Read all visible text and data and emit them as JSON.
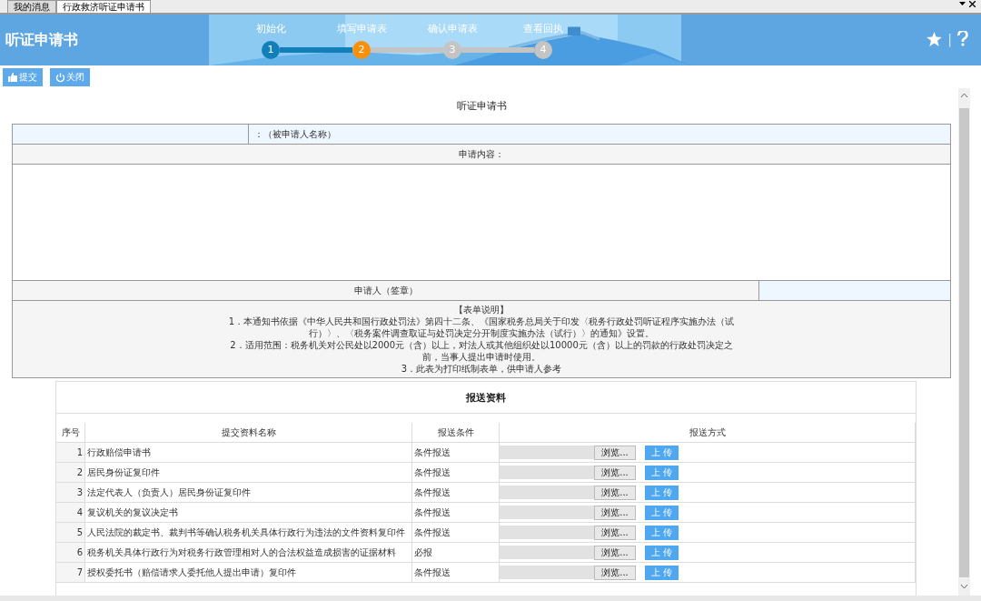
{
  "tabs": [
    {
      "label": "我的消息",
      "selected": false
    },
    {
      "label": "行政救济听证申请书",
      "selected": true
    }
  ],
  "header": {
    "title": "听证申请书",
    "steps": [
      {
        "label": "初始化",
        "number": "1",
        "completed": true,
        "selected": false
      },
      {
        "label": "填写申请表",
        "number": "2",
        "completed": false,
        "selected": true
      },
      {
        "label": "确认申请表",
        "number": "3",
        "completed": false,
        "selected": false
      },
      {
        "label": "查看回执",
        "number": "4",
        "completed": false,
        "selected": false
      }
    ],
    "divider": "|"
  },
  "toolbar": [
    {
      "kind": "submit",
      "label": "提交"
    },
    {
      "kind": "close",
      "label": "关闭"
    }
  ],
  "form": {
    "title": "听证申请书",
    "applicant_name_label": "：（被申请人名称）",
    "content_label": "申请内容：",
    "signature_label": "申请人（签章）",
    "notes_title": "【表单说明】",
    "notes": [
      "1．本通知书依据《中华人民共和国行政处罚法》第四十二条、《国家税务总局关于印发〈税务行政处罚听证程序实施办法（试行）〉、〈税务案件调查取证与处罚决定分开制度实施办法（试行）〉的通知》设置。",
      "2．适用范围：税务机关对公民处以2000元（含）以上，对法人或其他组织处以10000元（含）以上的罚款的行政处罚决定之前，当事人提出申请时使用。",
      "3．此表为打印纸制表单，供申请人参考"
    ]
  },
  "materials": {
    "title": "报送资料",
    "columns": [
      "序号",
      "提交资料名称",
      "报送条件",
      "报送方式"
    ],
    "rows": [
      {
        "index": "1",
        "name": "行政赔偿申请书",
        "condition": "条件报送",
        "browse": "浏览...",
        "upload": "上 传"
      },
      {
        "index": "2",
        "name": "居民身份证复印件",
        "condition": "条件报送",
        "browse": "浏览...",
        "upload": "上 传"
      },
      {
        "index": "3",
        "name": "法定代表人（负责人）居民身份证复印件",
        "condition": "条件报送",
        "browse": "浏览...",
        "upload": "上 传"
      },
      {
        "index": "4",
        "name": "复议机关的复议决定书",
        "condition": "条件报送",
        "browse": "浏览...",
        "upload": "上 传"
      },
      {
        "index": "5",
        "name": "人民法院的裁定书、裁判书等确认税务机关具体行政行为违法的文件资料复印件",
        "condition": "条件报送",
        "browse": "浏览...",
        "upload": "上 传"
      },
      {
        "index": "6",
        "name": "税务机关具体行政行为对税务行政管理相对人的合法权益造成损害的证据材料",
        "condition": "必报",
        "browse": "浏览...",
        "upload": "上 传"
      },
      {
        "index": "7",
        "name": "授权委托书（赔偿请求人委托他人提出申请）复印件",
        "condition": "条件报送",
        "browse": "浏览...",
        "upload": "上 传"
      }
    ]
  }
}
